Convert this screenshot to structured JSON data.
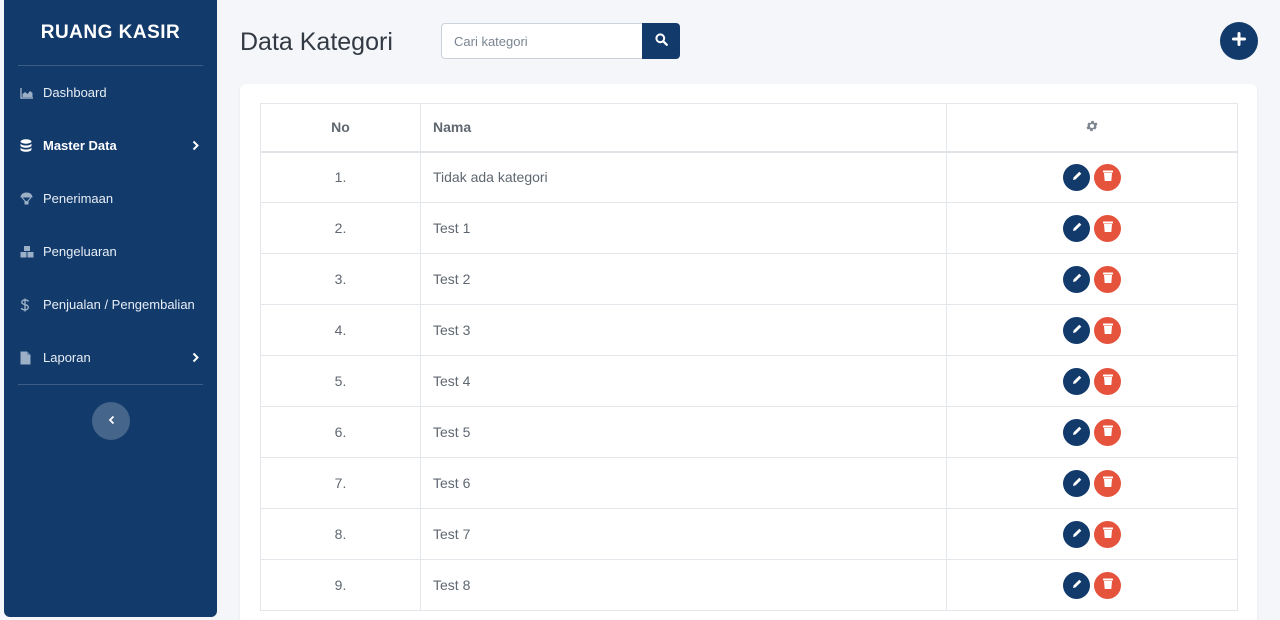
{
  "app": {
    "brand": "RUANG KASIR"
  },
  "colors": {
    "primary": "#123a6b",
    "danger": "#e5533d",
    "background": "#f4f6f9"
  },
  "sidebar": {
    "items": [
      {
        "label": "Dashboard",
        "icon": "chart-area-icon",
        "active": false
      },
      {
        "label": "Master Data",
        "icon": "database-icon",
        "active": true,
        "has_submenu": true
      },
      {
        "label": "Penerimaan",
        "icon": "parachute-box-icon",
        "active": false
      },
      {
        "label": "Pengeluaran",
        "icon": "boxes-icon",
        "active": false
      },
      {
        "label": "Penjualan / Pengembalian",
        "icon": "dollar-sign-icon",
        "active": false
      },
      {
        "label": "Laporan",
        "icon": "file-icon",
        "active": false,
        "has_submenu": true
      }
    ],
    "collapse_icon": "chevron-left-icon"
  },
  "header": {
    "title": "Data Kategori",
    "search": {
      "placeholder": "Cari kategori",
      "value": "",
      "button_icon": "search-icon"
    },
    "add_button_icon": "plus-icon"
  },
  "table": {
    "columns": {
      "no": "No",
      "nama": "Nama",
      "actions_icon": "gear-icon"
    },
    "rows": [
      {
        "no": "1.",
        "nama": "Tidak ada kategori"
      },
      {
        "no": "2.",
        "nama": "Test 1"
      },
      {
        "no": "3.",
        "nama": "Test 2"
      },
      {
        "no": "4.",
        "nama": "Test 3"
      },
      {
        "no": "5.",
        "nama": "Test 4"
      },
      {
        "no": "6.",
        "nama": "Test 5"
      },
      {
        "no": "7.",
        "nama": "Test 6"
      },
      {
        "no": "8.",
        "nama": "Test 7"
      },
      {
        "no": "9.",
        "nama": "Test 8"
      }
    ],
    "row_actions": [
      "pencil-icon",
      "trash-icon"
    ]
  }
}
